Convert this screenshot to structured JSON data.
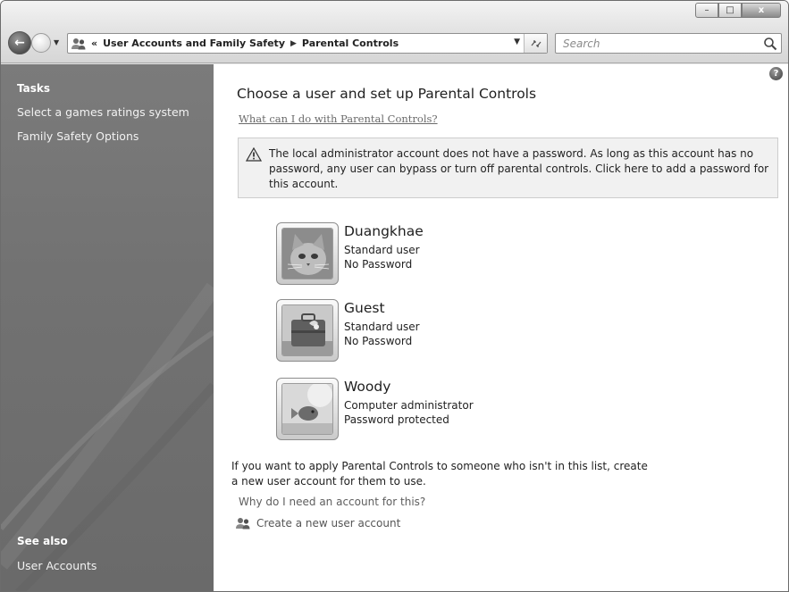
{
  "window": {
    "buttons": {
      "minimize": "–",
      "maximize": "□",
      "close": "x"
    }
  },
  "nav": {
    "breadcrumb_overflow": "«",
    "breadcrumbs": [
      "User Accounts and Family Safety",
      "Parental Controls"
    ],
    "search_placeholder": "Search"
  },
  "taskpane": {
    "tasks_heading": "Tasks",
    "task_links": [
      "Select a games ratings system",
      "Family Safety Options"
    ],
    "see_also_heading": "See also",
    "see_also_links": [
      "User Accounts"
    ]
  },
  "main": {
    "title": "Choose a user and set up Parental Controls",
    "help_link": "What can I do with Parental Controls?",
    "warning": "The local administrator account does not have a password. As long as this account has no password, any user can bypass or turn off parental controls. Click here to add a password for this account.",
    "users": [
      {
        "name": "Duangkhae",
        "type": "Standard user",
        "password": "No Password",
        "picture": "kitten"
      },
      {
        "name": "Guest",
        "type": "Standard user",
        "password": "No Password",
        "picture": "briefcase"
      },
      {
        "name": "Woody",
        "type": "Computer administrator",
        "password": "Password protected",
        "picture": "fish"
      }
    ],
    "note": "If you want to apply Parental Controls to someone who isn't in this list, create a new user account for them to use.",
    "why_link": "Why do I need an account for this?",
    "create_link": "Create a new user account"
  }
}
